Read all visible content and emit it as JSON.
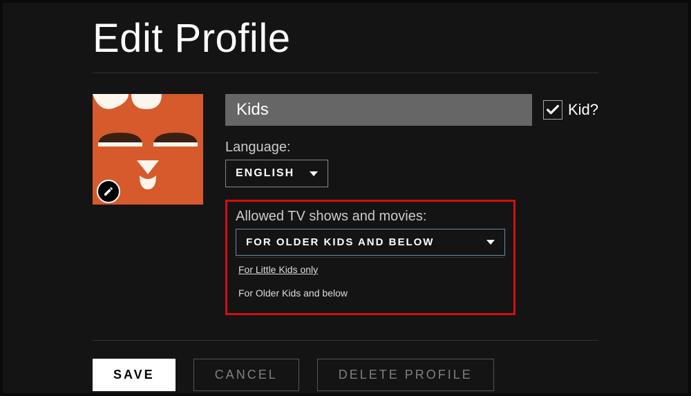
{
  "page": {
    "title": "Edit Profile"
  },
  "profile": {
    "name_value": "Kids",
    "kid_checked": true,
    "kid_label": "Kid?"
  },
  "language": {
    "label": "Language:",
    "selected": "ENGLISH"
  },
  "allowed": {
    "label": "Allowed TV shows and movies:",
    "selected": "FOR OLDER KIDS AND BELOW",
    "options": [
      "For Little Kids only",
      "For Older Kids and below"
    ]
  },
  "buttons": {
    "save": "SAVE",
    "cancel": "CANCEL",
    "delete": "DELETE PROFILE"
  }
}
